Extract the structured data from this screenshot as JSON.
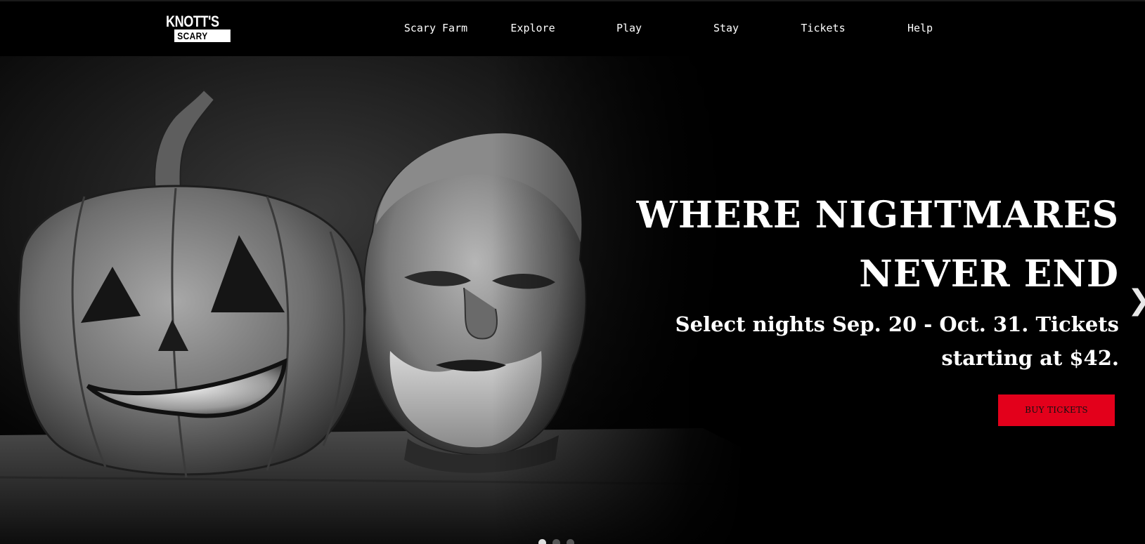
{
  "logo": {
    "top_text": "KNOTT'S",
    "bottom_text": "SCARY FARM"
  },
  "nav": {
    "items": [
      {
        "label": "Scary Farm"
      },
      {
        "label": "Explore"
      },
      {
        "label": "Play"
      },
      {
        "label": "Stay"
      },
      {
        "label": "Tickets"
      },
      {
        "label": "Help"
      }
    ]
  },
  "hero": {
    "headline_line1": "WHERE NIGHTMARES",
    "headline_line2": "NEVER END",
    "subhead_line1": "Select nights Sep. 20 - Oct. 31. Tickets",
    "subhead_line2": "starting at $42.",
    "cta_label": "BUY TICKETS",
    "next_glyph": "❯",
    "slide_count": 3,
    "active_slide": 1
  },
  "colors": {
    "background": "#000000",
    "cta": "#e3001b",
    "text": "#ffffff"
  },
  "icons": {
    "next": "chevron-right-icon"
  }
}
